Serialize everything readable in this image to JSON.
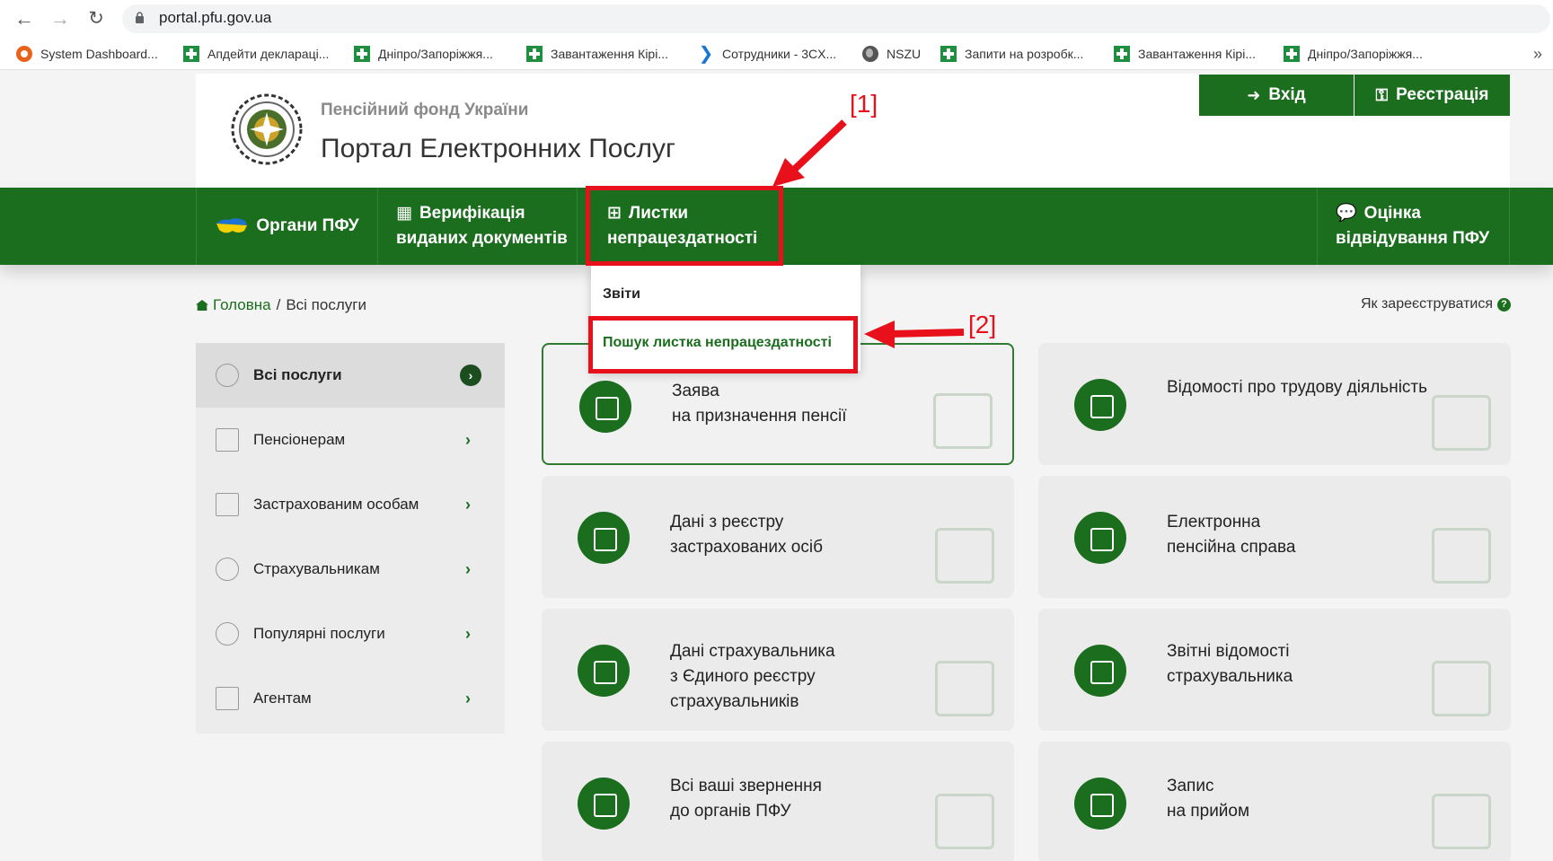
{
  "browser": {
    "url": "portal.pfu.gov.ua",
    "bookmarks": [
      {
        "label": "System Dashboard...",
        "icon": "orange-circle-icon"
      },
      {
        "label": "Апдейти деклараці...",
        "icon": "green-plus-icon"
      },
      {
        "label": "Дніпро/Запоріжжя...",
        "icon": "green-plus-icon"
      },
      {
        "label": "Завантаження Кірі...",
        "icon": "green-plus-icon"
      },
      {
        "label": "Сотрудники - 3CX...",
        "icon": "blue-chevron-icon"
      },
      {
        "label": "NSZU",
        "icon": "globe-icon"
      },
      {
        "label": "Запити на розробк...",
        "icon": "green-plus-icon"
      },
      {
        "label": "Завантаження Кірі...",
        "icon": "green-plus-icon"
      },
      {
        "label": "Дніпро/Запоріжжя...",
        "icon": "green-plus-icon"
      }
    ],
    "more": "»"
  },
  "header": {
    "org_name": "Пенсійний фонд України",
    "portal_name": "Портал Електронних Послуг",
    "login": "Вхід",
    "register": "Реєстрація"
  },
  "nav": {
    "organs": "Органи ПФУ",
    "verification_1": "Верифікація",
    "verification_2": "виданих документів",
    "sick_leave_1": "Листки",
    "sick_leave_2": "непрацездатності",
    "rating_1": "Оцінка",
    "rating_2": "відвідування ПФУ"
  },
  "dropdown": {
    "reports": "Звіти",
    "search": "Пошук листка непрацездатності"
  },
  "breadcrumb": {
    "home": "Головна",
    "separator": "/",
    "current": "Всі послуги"
  },
  "how_register": "Як зареєструватися",
  "sidebar": {
    "items": [
      {
        "label": "Всі послуги"
      },
      {
        "label": "Пенсіонерам"
      },
      {
        "label": "Застрахованим особам"
      },
      {
        "label": "Страхувальникам"
      },
      {
        "label": "Популярні послуги"
      },
      {
        "label": "Агентам"
      }
    ]
  },
  "cards": [
    {
      "line1": "Заява",
      "line2": "на призначення пенсії",
      "line3": ""
    },
    {
      "line1": "Відомості про трудову діяльність",
      "line2": "",
      "line3": ""
    },
    {
      "line1": "Дані з реєстру",
      "line2": "застрахованих осіб",
      "line3": ""
    },
    {
      "line1": "Електронна",
      "line2": "пенсійна справа",
      "line3": ""
    },
    {
      "line1": "Дані страхувальника",
      "line2": "з Єдиного реєстру",
      "line3": "страхувальників"
    },
    {
      "line1": "Звітні відомості",
      "line2": "страхувальника",
      "line3": ""
    },
    {
      "line1": "Всі ваші звернення",
      "line2": "до органів ПФУ",
      "line3": ""
    },
    {
      "line1": "Запис",
      "line2": "на прийом",
      "line3": ""
    }
  ],
  "annotations": {
    "label1": "[1]",
    "label2": "[2]"
  },
  "colors": {
    "brand_green": "#1b6e1e",
    "annotation_red": "#e8101a"
  }
}
